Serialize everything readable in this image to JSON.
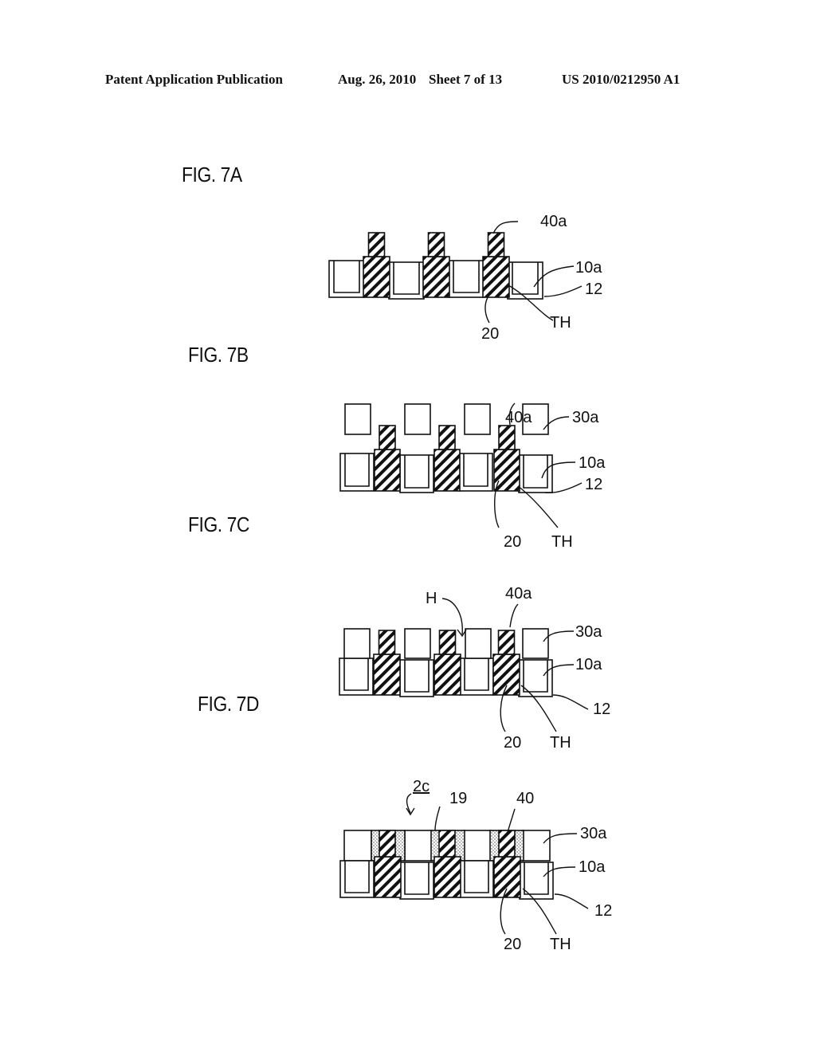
{
  "header": {
    "left": "Patent Application Publication",
    "date": "Aug. 26, 2010",
    "sheet": "Sheet 7 of 13",
    "number": "US 2010/0212950 A1"
  },
  "figures": [
    {
      "id": "7A",
      "label": "FIG. 7A",
      "refs": {
        "r40": "40a",
        "r10": "10a",
        "r12": "12",
        "r20": "20",
        "rTH": "TH"
      }
    },
    {
      "id": "7B",
      "label": "FIG. 7B",
      "refs": {
        "r40": "40a",
        "r30": "30a",
        "r10": "10a",
        "r12": "12",
        "r20": "20",
        "rTH": "TH"
      }
    },
    {
      "id": "7C",
      "label": "FIG. 7C",
      "refs": {
        "rH": "H",
        "r40": "40a",
        "r30": "30a",
        "r10": "10a",
        "r12": "12",
        "r20": "20",
        "rTH": "TH"
      }
    },
    {
      "id": "7D",
      "label": "FIG. 7D",
      "refs": {
        "r2c": "2c",
        "r19": "19",
        "r40": "40",
        "r30": "30a",
        "r10": "10a",
        "r12": "12",
        "r20": "20",
        "rTH": "TH"
      }
    }
  ]
}
